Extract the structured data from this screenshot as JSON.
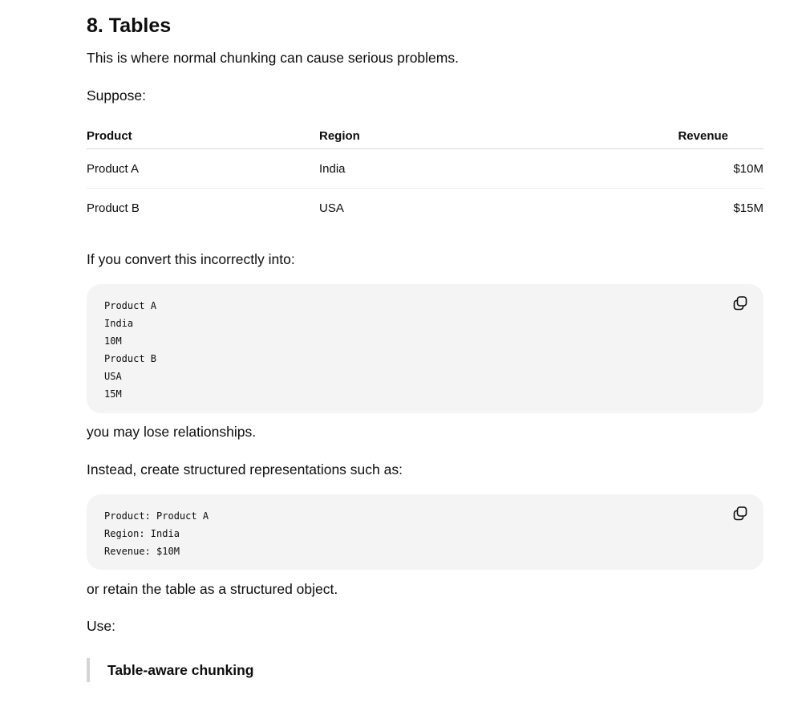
{
  "section": {
    "heading": "8. Tables",
    "intro": "This is where normal chunking can cause serious problems.",
    "suppose": "Suppose:"
  },
  "table": {
    "headers": [
      "Product",
      "Region",
      "Revenue"
    ],
    "rows": [
      [
        "Product A",
        "India",
        "$10M"
      ],
      [
        "Product B",
        "USA",
        "$15M"
      ]
    ]
  },
  "text": {
    "convert": "If you convert this incorrectly into:",
    "lose": "you may lose relationships.",
    "instead": "Instead, create structured representations such as:",
    "retain": "or retain the table as a structured object.",
    "use": "Use:"
  },
  "code_blocks": [
    {
      "content": "Product A\nIndia\n10M\nProduct B\nUSA\n15M",
      "copy_icon": "copy-icon"
    },
    {
      "content": "Product: Product A\nRegion: India\nRevenue: $10M",
      "copy_icon": "copy-icon"
    }
  ],
  "quote": {
    "text": "Table-aware chunking"
  }
}
